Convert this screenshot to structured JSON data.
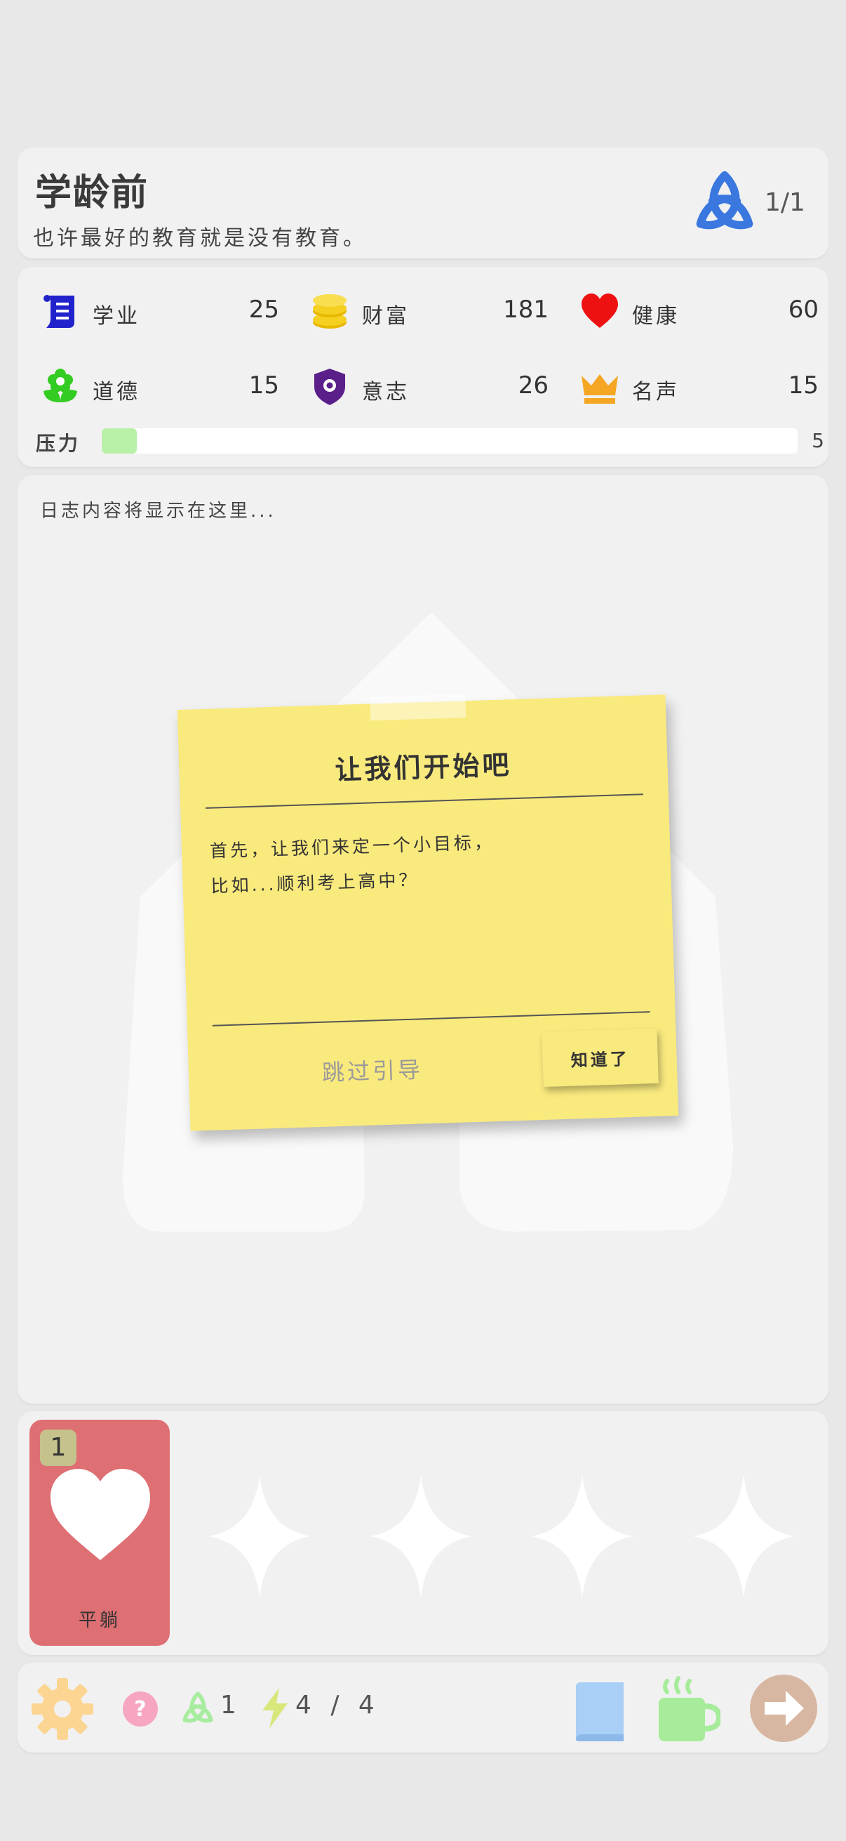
{
  "header": {
    "title": "学龄前",
    "subtitle": "也许最好的教育就是没有教育。",
    "counter": "1/1"
  },
  "stats": {
    "study": {
      "label": "学业",
      "value": "25"
    },
    "wealth": {
      "label": "财富",
      "value": "181"
    },
    "health": {
      "label": "健康",
      "value": "60"
    },
    "morality": {
      "label": "道德",
      "value": "15"
    },
    "will": {
      "label": "意志",
      "value": "26"
    },
    "fame": {
      "label": "名声",
      "value": "15"
    },
    "pressure": {
      "label": "压力",
      "value": "5",
      "fill_percent": 5
    }
  },
  "log": {
    "placeholder": "日志内容将显示在这里..."
  },
  "note": {
    "title": "让我们开始吧",
    "line1": "首先，让我们来定一个小目标，",
    "line2": "比如...顺利考上高中？",
    "skip_label": "跳过引导",
    "ok_label": "知道了"
  },
  "cards": {
    "card1": {
      "badge": "1",
      "label": "平躺",
      "icon": "heart-icon"
    },
    "empty_slots": 4
  },
  "bottombar": {
    "chain_count": "1",
    "energy": "4 / 4"
  },
  "colors": {
    "study": "#2222cc",
    "wealth": "#f5d020",
    "health": "#ee1111",
    "morality": "#33cc22",
    "will": "#5b1f8a",
    "fame": "#f5a623",
    "triquetra": "#3a78e0",
    "card": "#de6f73",
    "note": "#f9ea7e",
    "pressure_fill": "#b8f0a8"
  }
}
